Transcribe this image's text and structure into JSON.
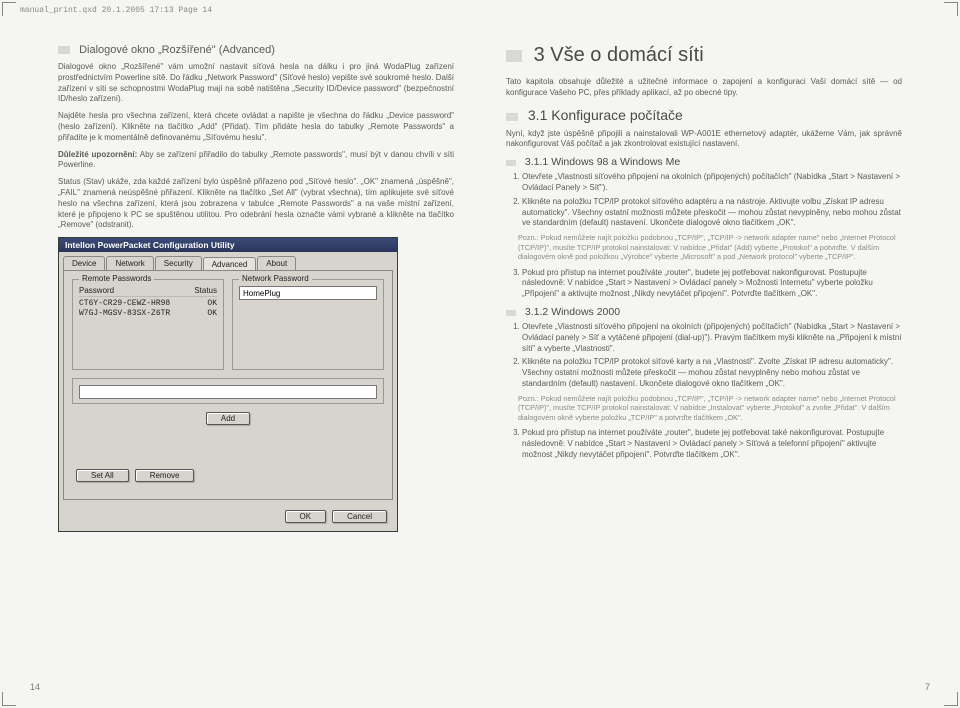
{
  "header_note": "manual_print.qxd  20.1.2005  17:13  Page 14",
  "left": {
    "section_title": "Dialogové okno „Rozšířené\" (Advanced)",
    "p1": "Dialogové okno „Rozšířené\" vám umožní nastavit síťová hesla na dálku i pro jiná WodaPlug zařízení prostřednictvím Powerline sítě. Do řádku „Network Password\" (Síťové heslo) vepište své soukromé heslo. Další zařízení v síti se schopnostmi WodaPlug mají na sobě natištěna „Security ID/Device password\" (bezpečnostní ID/heslo zařízení).",
    "p2": "Najděte hesla pro všechna zařízení, která chcete ovládat a napište je všechna do řádku „Device password\" (heslo zařízení). Klikněte na tlačítko „Add\" (Přidat). Tím přidáte hesla do tabulky „Remote Passwords\" a přiřadíte je k momentálně definovanému „Síťovému heslu\".",
    "p3a": "Důležité upozornění:",
    "p3b": " Aby se zařízení přiřadilo do tabulky „Remote passwords\", musí být v danou chvíli v síti Powerline.",
    "p4": "Status (Stav) ukáže, zda každé zařízení bylo úspěšně přiřazeno pod „Síťové heslo\". „OK\" znamená „úspěšně\", „FAIL\" znamená neúspěšné přiřazení. Klikněte na tlačítko „Set All\" (vybrat všechna), tím aplikujete své síťové heslo na všechna zařízení, která jsou zobrazena v tabulce „Remote Passwords\" a na vaše místní zařízení, které je připojeno k PC se spuštěnou utilitou. Pro odebrání hesla označte vámi vybrané a klikněte na tlačítko „Remove\" (odstranit)."
  },
  "dialog": {
    "title": "Intellon PowerPacket Configuration Utility",
    "tabs": [
      "Device",
      "Network",
      "Security",
      "Advanced",
      "About"
    ],
    "active_tab": "Advanced",
    "group_remote": "Remote Passwords",
    "group_network": "Network Password",
    "col_password": "Password",
    "col_status": "Status",
    "rows": [
      {
        "pw": "CT6Y-CR29-CEWZ-HR98",
        "st": "OK"
      },
      {
        "pw": "W7GJ-MGSV-83SX-Z6TR",
        "st": "OK"
      }
    ],
    "netpw": "HomePlug",
    "btn_add": "Add",
    "btn_setall": "Set All",
    "btn_remove": "Remove",
    "btn_ok": "OK",
    "btn_cancel": "Cancel"
  },
  "right": {
    "chapter": "3 Vše o domácí síti",
    "intro": "Tato kapitola obsahuje důležité a užitečné informace o zapojení a konfiguraci Vaší domácí sítě — od konfigurace Vašeho PC, přes příklady aplikací, až po obecné tipy.",
    "s31": "3.1 Konfigurace počítače",
    "s31_p": "Nyní, když jste úspěšně připojili a nainstalovali WP-A001E ethernetový adaptér, ukážeme Vám, jak správně nakonfigurovat Váš počítač a jak zkontrolovat existující nastavení.",
    "s311": "3.1.1 Windows 98 a Windows Me",
    "s311_steps": [
      "Otevřete „Vlastnosti síťového připojení na okolních (připojených) počítačích\" (Nabídka „Start > Nastavení > Ovládací Panely > Síť\").",
      "Klikněte na položku TCP/IP protokol síťového adaptéru a na nástroje. Aktivujte volbu „Získat IP adresu automaticky\". Všechny ostatní možnosti můžete přeskočit — mohou zůstat nevyplněny, nebo mohou zůstat ve standardním (default) nastavení. Ukončete dialogové okno tlačítkem „OK\"."
    ],
    "note1": "Pozn.: Pokud nemůžete najít položku podobnou „TCP/IP\", „TCP/IP -> network adapter name\" nebo „Internet Protocol (TCP/IP)\", musíte TCP/IP protokol nainstalovat: V nabídce „Přidat\" (Add) vyberte „Protokol\" a potvrďte. V dalším dialogovém okně pod položkou „Výrobce\" vyberte „Microsoft\" a pod „Network protocol\" vyberte „TCP/IP\".",
    "s311_step3": "Pokud pro přístup na internet používáte „router\", budete jej potřebovat nakonfigurovat. Postupujte následovně: V nabídce „Start > Nastavení > Ovládací panely > Možnosti Internetu\" vyberte položku „Připojení\" a aktivujte možnost „Nikdy nevytáčet připojení\". Potvrďte tlačítkem „OK\".",
    "s312": "3.1.2 Windows 2000",
    "s312_steps": [
      "Otevřete „Vlastnosti síťového připojení na okolních (připojených) počítačích\" (Nabídka „Start > Nastavení > Ovládací panely > Síť a vytáčené připojení (dial-up)\"). Pravým tlačítkem myši klikněte na „Připojení k místní síti\" a vyberte „Vlastnosti\".",
      "Klikněte na položku TCP/IP protokol síťové karty a na „Vlastnosti\". Zvolte „Získat IP adresu automaticky\". Všechny ostatní možnosti můžete přeskočit — mohou zůstat nevyplněny nebo mohou zůstat ve standardním (default) nastavení. Ukončete dialogové okno tlačítkem „OK\"."
    ],
    "note2": "Pozn.: Pokud nemůžete najít položku podobnou „TCP/IP\", „TCP/IP -> network adapter name\" nebo „Internet Protocol (TCP/IP)\", musíte TCP/IP protokol nainstalovat: V nabídce „Instalovat\" vyberte „Protokol\" a zvolte „Přidat\". V dalším dialogovém okně vyberte položku „TCP/IP\" a potvrďte tlačítkem „OK\".",
    "s312_step3": "Pokud pro přístup na internet používáte „router\", budete jej potřebovat také nakonfigurovat. Postupujte následovně: V nabídce „Start > Nastavení > Ovládací panely > Síťová a telefonní připojení\" aktivujte možnost „Nikdy nevytáčet připojení\". Potvrďte tlačítkem „OK\"."
  },
  "page_left_num": "14",
  "page_right_num": "7"
}
